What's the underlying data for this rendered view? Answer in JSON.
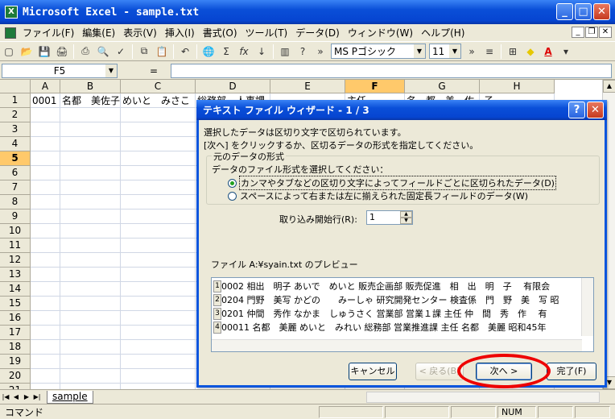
{
  "window": {
    "title": "Microsoft Excel - sample.txt",
    "buttons": [
      "_",
      "□",
      "✕"
    ]
  },
  "menu": [
    "ファイル(F)",
    "編集(E)",
    "表示(V)",
    "挿入(I)",
    "書式(O)",
    "ツール(T)",
    "データ(D)",
    "ウィンドウ(W)",
    "ヘルプ(H)"
  ],
  "toolbar": {
    "font_name": "MS Pゴシック",
    "font_size": "11"
  },
  "formula_bar": {
    "name_box": "F5",
    "equals": "="
  },
  "columns": [
    "A",
    "B",
    "C",
    "D",
    "E",
    "F",
    "G",
    "H"
  ],
  "rows": [
    "1",
    "2",
    "3",
    "4",
    "5",
    "6",
    "7",
    "8",
    "9",
    "10",
    "11",
    "12",
    "13",
    "14",
    "15",
    "16",
    "17",
    "18",
    "19",
    "20",
    "21"
  ],
  "row1": {
    "a": "0001",
    "b": "名都　美佐子",
    "c": "めいと　みさこ",
    "d": "総務部　人事課",
    "f": "主任",
    "g": "名　都　美　佐　子"
  },
  "sheet_tab": "sample",
  "status": {
    "mode": "コマンド",
    "num": "NUM"
  },
  "dialog": {
    "title": "テキスト ファイル ウィザード - 1 / 3",
    "help_button": "?",
    "close_button": "✕",
    "line1": "選択したデータは区切り文字で区切られています。",
    "line2": "[次へ] をクリックするか、区切るデータの形式を指定してください。",
    "group_label": "元のデータの形式",
    "group_prompt": "データのファイル形式を選択してください：",
    "option_delimited": "カンマやタブなどの区切り文字によってフィールドごとに区切られたデータ(D)",
    "option_fixed": "スペースによって右または左に揃えられた固定長フィールドのデータ(W)",
    "start_row_label": "取り込み開始行(R):",
    "start_row_value": "1",
    "preview_label": "ファイル A:¥syain.txt のプレビュー",
    "preview_rows": [
      {
        "n": "1",
        "text": "0002 相出　明子 あいで　めいと 販売企画部 販売促進　相　出　明　子　 有限会"
      },
      {
        "n": "2",
        "text": "0204 門野　美写 かどの　　みーしゃ 研究開発センター 検査係　門　野　美　写 昭"
      },
      {
        "n": "3",
        "text": "0201 仲間　秀作 なかま　しゅうさく 営業部 営業１課 主任 仲　間　秀　作　 有"
      },
      {
        "n": "4",
        "text": "00011 名都　美麗 めいと　みれい 総務部 営業推進課 主任 名都　美麗 昭和45年"
      }
    ],
    "cancel": "キャンセル",
    "back": "< 戻る(B)",
    "next": "次へ >",
    "finish": "完了(F)"
  }
}
